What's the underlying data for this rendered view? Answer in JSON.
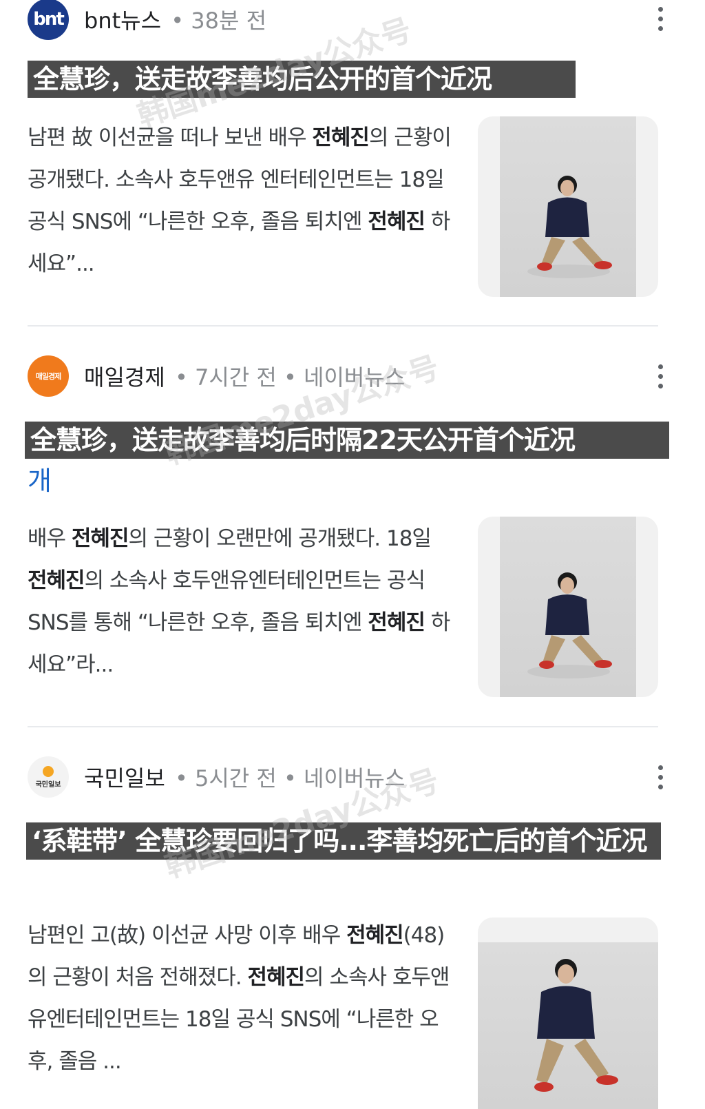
{
  "articles": [
    {
      "source": "bnt뉴스",
      "logo_text": "bnt",
      "meta": " • 38분 전",
      "headline_original": "",
      "overlay_title": "全慧珍，送走故李善均后公开的首个近况",
      "snippet": [
        "남편 故 이선균을 떠나 보낸 배우 ",
        "전혜진",
        "의 근황이 공개됐다. 소속사 호두앤유 엔터테인먼트는 18일 공식 SNS에 “나른한 오후, 졸음 퇴치엔 ",
        "전혜진",
        " 하세요”..."
      ],
      "thumb_icon": "woman-sitting-photo"
    },
    {
      "source": "매일경제",
      "logo_text": "매일경제",
      "meta": " • 7시간 전 • 네이버뉴스",
      "headline_original": "개",
      "overlay_title": "全慧珍，送走故李善均后时隔22天公开首个近况",
      "snippet": [
        "배우 ",
        "전혜진",
        "의 근황이 오랜만에 공개됐다. 18일 ",
        "전혜진",
        "의 소속사 호두앤유엔터테인먼트는 공식 SNS를 통해 “나른한 오후, 졸음 퇴치엔 ",
        "전혜진",
        " 하세요”라..."
      ],
      "thumb_icon": "woman-sitting-photo"
    },
    {
      "source": "국민일보",
      "logo_text": "국민일보",
      "meta": " • 5시간 전 • 네이버뉴스",
      "headline_original": "",
      "overlay_title": "‘系鞋带’ 全慧珍要回归了吗...李善均死亡后的首个近况",
      "snippet": [
        "남편인 고(故) 이선균 사망 이후 배우 ",
        "전혜진",
        "(48)의 근황이 처음 전해졌다. ",
        "전혜진",
        "의 소속사 호두앤유엔터테인먼트는 18일 공식 SNS에 “나른한 오후, 졸음 ..."
      ],
      "thumb_icon": "woman-sitting-photo"
    }
  ],
  "watermark": "韩国me2day公众号"
}
